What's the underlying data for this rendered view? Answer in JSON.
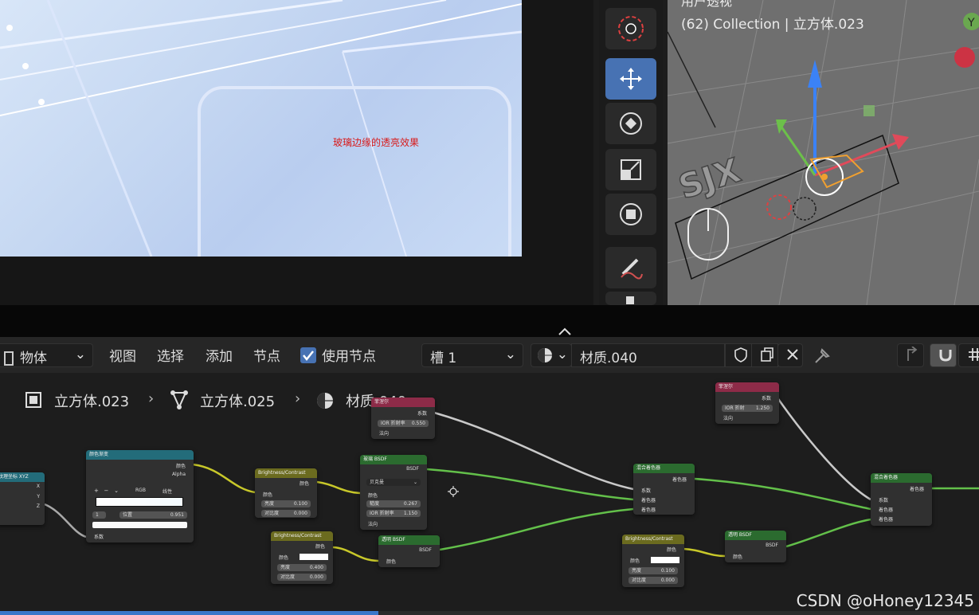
{
  "render": {
    "caption": "玻璃边缘的透亮效果"
  },
  "viewport": {
    "partial_header": "用户透视",
    "title": "(62) Collection | 立方体.023"
  },
  "header": {
    "object_mode": "物体",
    "menus": [
      "视图",
      "选择",
      "添加",
      "节点"
    ],
    "use_nodes_label": "使用节点",
    "slot": "槽 1",
    "material_name": "材质.040"
  },
  "breadcrumb": {
    "object": "立方体.023",
    "mesh": "立方体.025",
    "material": "材质.040"
  },
  "nodes": {
    "coord": {
      "title": "纹理坐标 XYZ",
      "outs": [
        "X",
        "Y",
        "Z"
      ]
    },
    "ramp": {
      "title": "颜色渐变",
      "out1": "颜色",
      "out2": "Alpha",
      "mode": "RGB",
      "interp": "线性",
      "stop": "1",
      "pos_label": "位置",
      "pos_val": "0.951",
      "in": "系数"
    },
    "bc1": {
      "title": "Brightness/Contrast",
      "out": "颜色",
      "in": "颜色",
      "b_label": "亮度",
      "b_val": "0.100",
      "c_label": "对比度",
      "c_val": "0.000"
    },
    "fresnel1": {
      "title": "菲涅尔",
      "out": "系数",
      "ior_label": "IOR 折射率",
      "ior_val": "0.550",
      "normal": "法向"
    },
    "glass": {
      "title": "玻璃 BSDF",
      "out": "BSDF",
      "dist": "贝克曼",
      "in_color": "颜色",
      "rough_label": "糙度",
      "rough_val": "0.267",
      "ior_label": "IOR 折射率",
      "ior_val": "1.150",
      "normal": "法向"
    },
    "bc2": {
      "title": "Brightness/Contrast",
      "out": "颜色",
      "in": "颜色",
      "b_label": "亮度",
      "b_val": "0.400",
      "c_label": "对比度",
      "c_val": "0.000"
    },
    "transp1": {
      "title": "透明 BSDF",
      "out": "BSDF",
      "in": "颜色"
    },
    "mix1": {
      "title": "混合着色器",
      "out": "着色器",
      "in1": "系数",
      "in2": "着色器",
      "in3": "着色器"
    },
    "fresnel2": {
      "title": "菲涅尔",
      "out": "系数",
      "ior_label": "IOR 折射",
      "ior_val": "1.250",
      "normal": "法向"
    },
    "bc3": {
      "title": "Brightness/Contrast",
      "out": "颜色",
      "in": "颜色",
      "b_label": "亮度",
      "b_val": "0.100",
      "c_label": "对比度",
      "c_val": "0.000"
    },
    "transp2": {
      "title": "透明 BSDF",
      "out": "BSDF",
      "in": "颜色"
    },
    "mix2": {
      "title": "混合着色器",
      "out": "着色器",
      "in1": "系数",
      "in2": "着色器",
      "in3": "着色器"
    }
  },
  "watermark": "CSDN @oHoney12345",
  "colors": {
    "accent": "#4772b3",
    "link_yellow": "#c8c82a",
    "link_green": "#63c04a",
    "link_grey": "#c9c9c9",
    "caption_red": "#d81b1b"
  }
}
